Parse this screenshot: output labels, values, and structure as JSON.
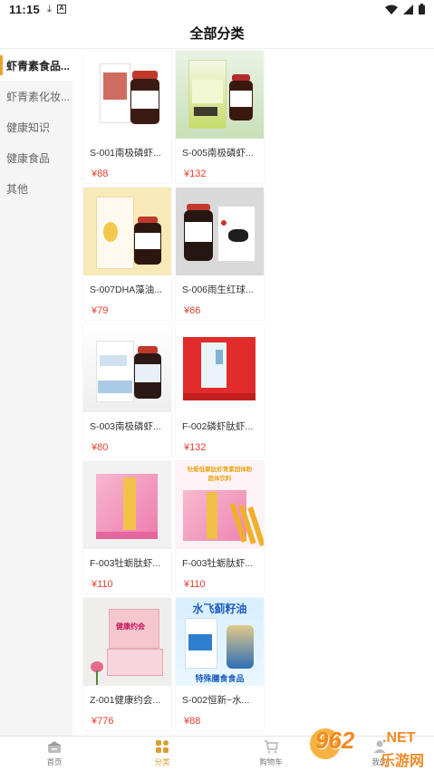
{
  "status_bar": {
    "time": "11:15",
    "icons": [
      "download-icon",
      "a-notification-icon",
      "wifi-icon",
      "signal-icon",
      "battery-icon"
    ],
    "a_glyph": "A"
  },
  "header": {
    "title": "全部分类"
  },
  "sidebar": {
    "items": [
      {
        "label": "虾青素食品...",
        "active": true
      },
      {
        "label": "虾青素化妆...",
        "active": false
      },
      {
        "label": "健康知识",
        "active": false
      },
      {
        "label": "健康食品",
        "active": false
      },
      {
        "label": "其他",
        "active": false
      }
    ]
  },
  "products": [
    {
      "name": "S-001南极磷虾...",
      "price": "¥88"
    },
    {
      "name": "S-005南极磷虾...",
      "price": "¥132"
    },
    {
      "name": "S-007DHA藻油...",
      "price": "¥79"
    },
    {
      "name": "S-006雨生红球...",
      "price": "¥66"
    },
    {
      "name": "S-003南极磷虾...",
      "price": "¥80"
    },
    {
      "name": "F-002磷虾肽虾...",
      "price": "¥132"
    },
    {
      "name": "F-003牡蛎肽虾...",
      "price": "¥110"
    },
    {
      "name": "F-003牡蛎肽虾...",
      "price": "¥110"
    },
    {
      "name": "Z-001健康约会...",
      "price": "¥776"
    },
    {
      "name": "S-002恒新~水...",
      "price": "¥88"
    }
  ],
  "product_image_text": {
    "p8_banner": "牡蛎低聚肽虾青素固体粉",
    "p8_banner2": "固体饮料",
    "p9_box": "健康约会",
    "p10_title": "水飞蓟籽油",
    "p10_sub": "特殊膳食食品"
  },
  "bottom_nav": {
    "items": [
      {
        "label": "首页",
        "icon": "home-icon",
        "active": false
      },
      {
        "label": "分类",
        "icon": "category-icon",
        "active": true
      },
      {
        "label": "购物车",
        "icon": "cart-icon",
        "active": false
      },
      {
        "label": "我的",
        "icon": "user-icon",
        "active": false
      }
    ]
  },
  "watermark": {
    "brand": "962",
    "tld": ".NET",
    "cn": "乐游网"
  },
  "colors": {
    "accent": "#d9a033",
    "price": "#e23d2c",
    "sidebar_bg": "#f5f5f5"
  }
}
